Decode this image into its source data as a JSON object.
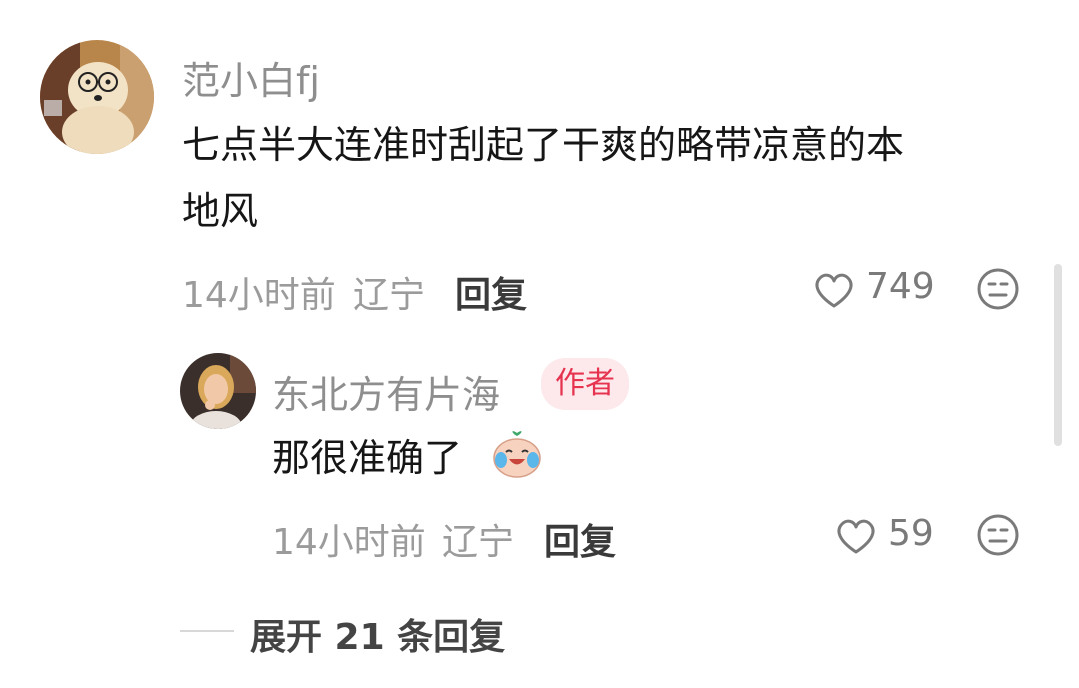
{
  "comment": {
    "username": "范小白fj",
    "text_line1": "七点半大连准时刮起了干爽的略带凉意的本",
    "text_line2": "地风",
    "time": "14小时前",
    "location": "辽宁",
    "reply_label": "回复",
    "likes": "749",
    "avatar_icon": "dog-with-glasses-avatar"
  },
  "reply": {
    "username": "东北方有片海",
    "badge": "作者",
    "text": "那很准确了",
    "emoji_icon": "crying-laughing-sticker-icon",
    "time": "14小时前",
    "location": "辽宁",
    "reply_label": "回复",
    "likes": "59",
    "avatar_icon": "woman-portrait-avatar"
  },
  "expand": {
    "label": "展开 21 条回复"
  },
  "colors": {
    "badge_bg": "#fde8ec",
    "badge_text": "#e6334f",
    "username": "#8e8e8e",
    "meta": "#9b9b9b"
  }
}
